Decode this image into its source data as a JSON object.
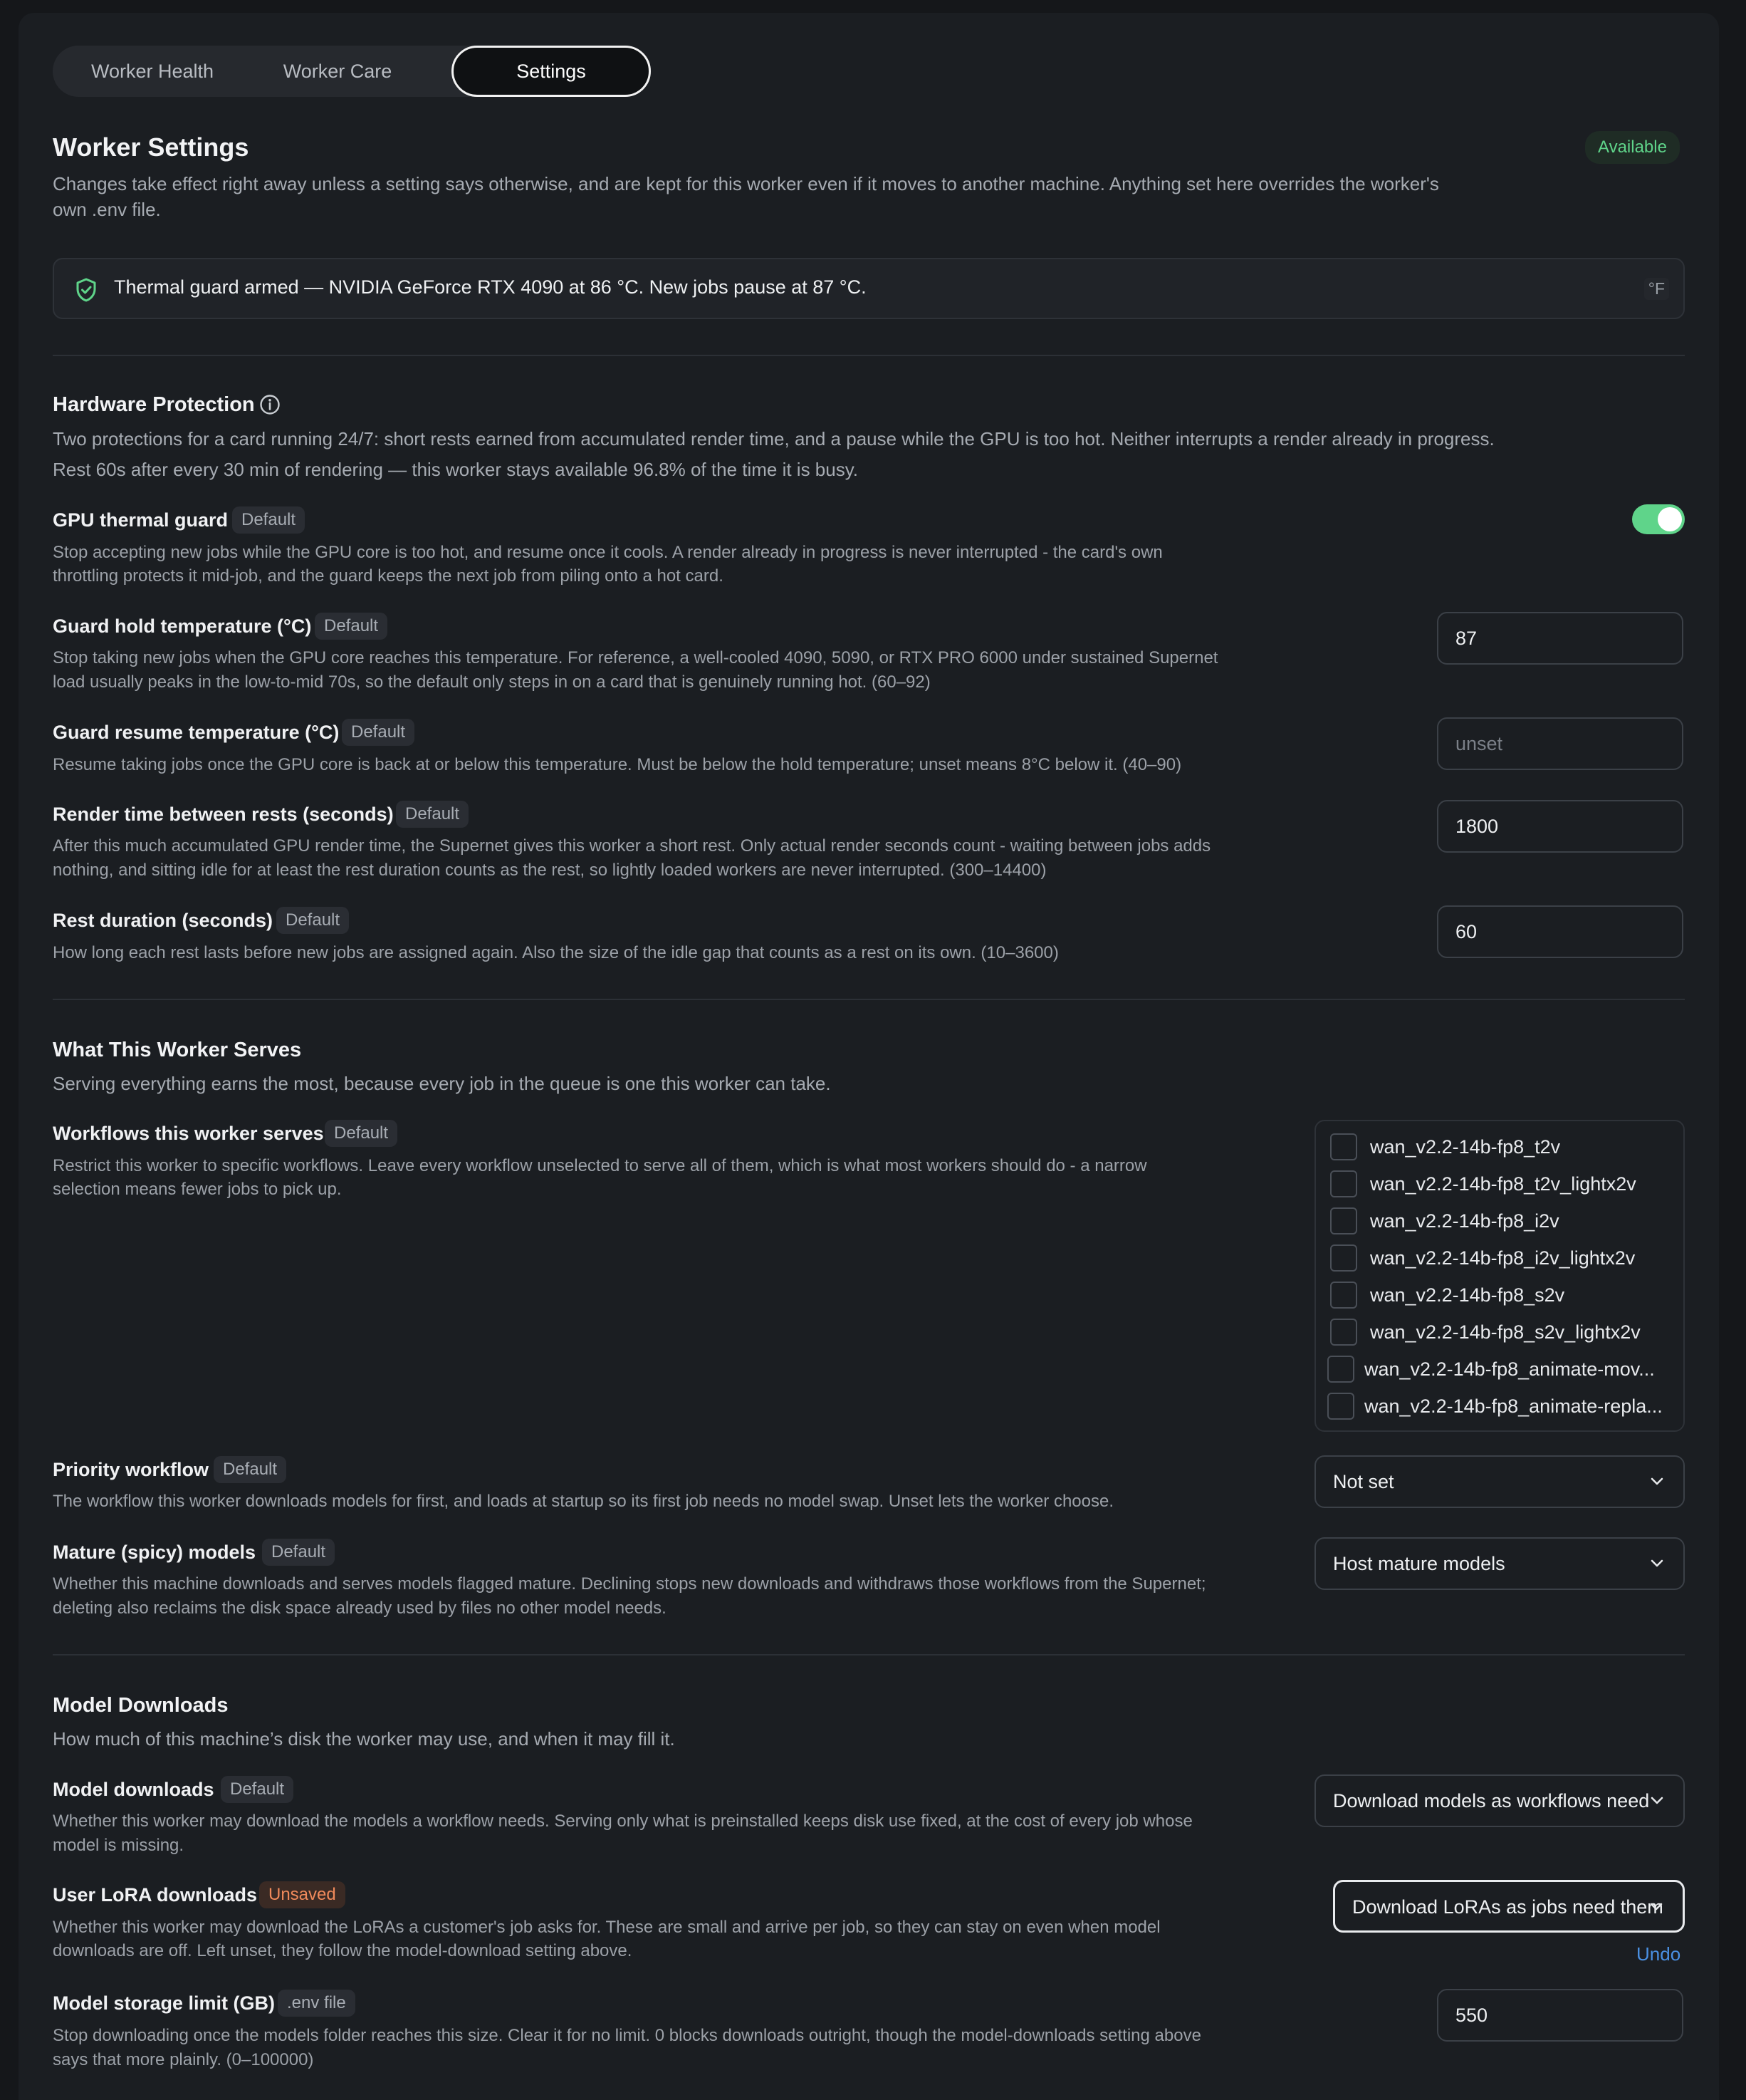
{
  "tabs": [
    "Worker Health",
    "Worker Care",
    "Settings"
  ],
  "header": {
    "title": "Worker Settings",
    "status": "Available",
    "desc_line1": "Changes take effect right away unless a setting says otherwise, and are kept for this worker even if it moves to another machine. Anything set here overrides the worker's",
    "desc_line2": "own .env file."
  },
  "banner": {
    "text": "Thermal guard armed — NVIDIA GeForce RTX 4090 at 86 °C. New jobs pause at 87 °C.",
    "unit_toggle": "°F"
  },
  "hardware": {
    "title": "Hardware Protection",
    "desc_line1": "Two protections for a card running 24/7: short rests earned from accumulated render time, and a pause while the GPU is too hot. Neither interrupts a render already in progress.",
    "desc_line2": "Rest 60s after every 30 min of rendering — this worker stays available 96.8% of the time it is busy.",
    "gpu_guard": {
      "label": "GPU thermal guard",
      "badge": "Default",
      "desc_line1": "Stop accepting new jobs while the GPU core is too hot, and resume once it cools. A render already in progress is never interrupted - the card's own",
      "desc_line2": "throttling protects it mid-job, and the guard keeps the next job from piling onto a hot card.",
      "enabled": true
    },
    "hold_temp": {
      "label": "Guard hold temperature (°C)",
      "badge": "Default",
      "desc_line1": "Stop taking new jobs when the GPU core reaches this temperature. For reference, a well-cooled 4090, 5090, or RTX PRO 6000 under sustained Supernet",
      "desc_line2": "load usually peaks in the low-to-mid 70s, so the default only steps in on a card that is genuinely running hot. (60–92)",
      "value": "87"
    },
    "resume_temp": {
      "label": "Guard resume temperature (°C)",
      "badge": "Default",
      "desc_line1": "Resume taking jobs once the GPU core is back at or below this temperature. Must be below the hold temperature; unset means 8°C below it. (40–90)",
      "placeholder": "unset"
    },
    "render_time": {
      "label": "Render time between rests (seconds)",
      "badge": "Default",
      "desc_line1": "After this much accumulated GPU render time, the Supernet gives this worker a short rest. Only actual render seconds count - waiting between jobs adds",
      "desc_line2": "nothing, and sitting idle for at least the rest duration counts as the rest, so lightly loaded workers are never interrupted. (300–14400)",
      "value": "1800"
    },
    "rest_duration": {
      "label": "Rest duration (seconds)",
      "badge": "Default",
      "desc_line1": "How long each rest lasts before new jobs are assigned again. Also the size of the idle gap that counts as a rest on its own. (10–3600)",
      "value": "60"
    }
  },
  "serves": {
    "title": "What This Worker Serves",
    "desc": "Serving everything earns the most, because every job in the queue is one this worker can take.",
    "workflows": {
      "label": "Workflows this worker serves",
      "badge": "Default",
      "desc_line1": "Restrict this worker to specific workflows. Leave every workflow unselected to serve all of them, which is what most workers should do - a narrow",
      "desc_line2": "selection means fewer jobs to pick up.",
      "items": [
        "wan_v2.2-14b-fp8_t2v",
        "wan_v2.2-14b-fp8_t2v_lightx2v",
        "wan_v2.2-14b-fp8_i2v",
        "wan_v2.2-14b-fp8_i2v_lightx2v",
        "wan_v2.2-14b-fp8_s2v",
        "wan_v2.2-14b-fp8_s2v_lightx2v",
        "wan_v2.2-14b-fp8_animate-mov...",
        "wan_v2.2-14b-fp8_animate-repla..."
      ]
    },
    "priority": {
      "label": "Priority workflow",
      "badge": "Default",
      "desc_line1": "The workflow this worker downloads models for first, and loads at startup so its first job needs no model swap. Unset lets the worker choose.",
      "value": "Not set"
    },
    "mature": {
      "label": "Mature (spicy) models",
      "badge": "Default",
      "desc_line1": "Whether this machine downloads and serves models flagged mature. Declining stops new downloads and withdraws those workflows from the Supernet;",
      "desc_line2": "deleting also reclaims the disk space already used by files no other model needs.",
      "value": "Host mature models"
    }
  },
  "downloads": {
    "title": "Model Downloads",
    "desc": "How much of this machine’s disk the worker may use, and when it may fill it.",
    "model_downloads": {
      "label": "Model downloads",
      "badge": "Default",
      "desc_line1": "Whether this worker may download the models a workflow needs. Serving only what is preinstalled keeps disk use fixed, at the cost of every job whose",
      "desc_line2": "model is missing.",
      "value": "Download models as workflows need"
    },
    "lora": {
      "label": "User LoRA downloads",
      "badge": "Unsaved",
      "desc_line1": "Whether this worker may download the LoRAs a customer's job asks for. These are small and arrive per job, so they can stay on even when model",
      "desc_line2": "downloads are off. Left unset, they follow the model-download setting above.",
      "value": "Download LoRAs as jobs need them",
      "undo": "Undo"
    },
    "storage": {
      "label": "Model storage limit (GB)",
      "badge": ".env file",
      "desc_line1": "Stop downloading once the models folder reaches this size. Clear it for no limit. 0 blocks downloads outright, though the model-downloads setting above",
      "desc_line2": "says that more plainly. (0–100000)",
      "value": "550"
    }
  },
  "colors": {
    "accent": "#5fd48a",
    "link": "#4a90e2",
    "warn": "#f08a5b",
    "background": "#1b1e22"
  }
}
